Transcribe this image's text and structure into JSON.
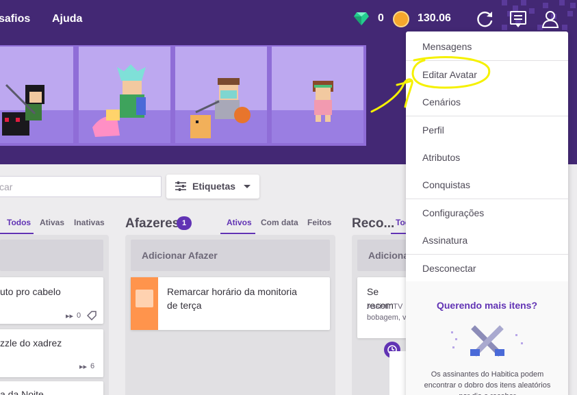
{
  "nav": {
    "links": [
      "safios",
      "Ajuda"
    ]
  },
  "wallet": {
    "gems": "0",
    "gold": "130.06"
  },
  "icons": {
    "gem": "gem-icon",
    "gold": "gold-coin-icon",
    "sync": "sync-icon",
    "notifications": "notifications-icon",
    "user": "user-icon"
  },
  "colors": {
    "brand": "#432874",
    "accent": "#6133b4",
    "todo": "#ff944c",
    "annotation": "#f5f100"
  },
  "toolbar": {
    "search_value": "car",
    "tags_label": "Etiquetas"
  },
  "columns": {
    "habits": {
      "tabs": [
        "Todos",
        "Ativas",
        "Inativas"
      ],
      "active_tab": "Todos",
      "tasks": [
        {
          "text": "uto pro cabelo",
          "streak": "0"
        },
        {
          "text": "zzle do xadrez",
          "streak": "6"
        },
        {
          "text": "a da Noite"
        }
      ]
    },
    "todos": {
      "title": "Afazeres",
      "badge": "1",
      "tabs": [
        "Ativos",
        "Com data",
        "Feitos"
      ],
      "active_tab": "Ativos",
      "add_label": "Adicionar Afazer",
      "tasks": [
        {
          "text_line1": "Remarcar horário da monitoria",
          "text_line2": "de terça"
        }
      ]
    },
    "rewards": {
      "title": "Reco...",
      "tab": "Tod",
      "add_label": "Adiciona",
      "tasks": [
        {
          "text": "Se recom",
          "note_line1": "Assistir TV",
          "note_line2": "bobagem, v"
        }
      ]
    }
  },
  "menu": {
    "items": [
      "Mensagens",
      "Editar Avatar",
      "Cenários",
      "Perfil",
      "Atributos",
      "Conquistas",
      "Configurações",
      "Assinatura",
      "Desconectar"
    ],
    "promo_title": "Querendo mais itens?",
    "promo_text": "Os assinantes do Habitica podem encontrar o dobro dos itens aleatórios por dia e receber"
  }
}
